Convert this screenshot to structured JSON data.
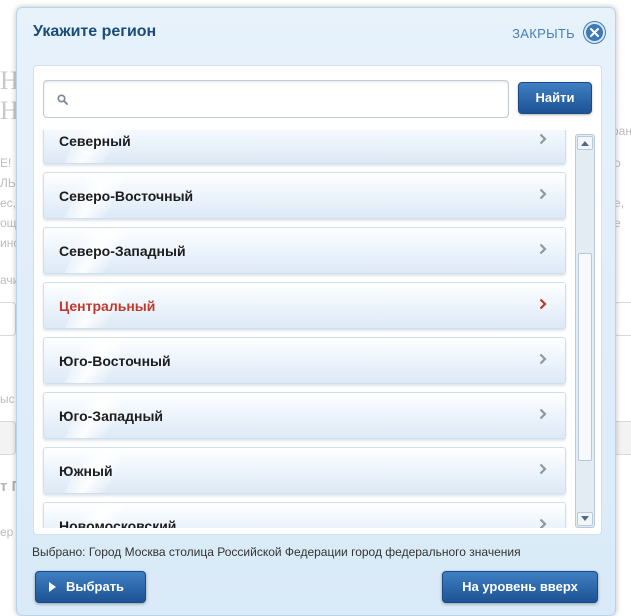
{
  "background": {
    "heading_fragments": [
      "Н",
      "Н"
    ],
    "text_fragments": [
      "E!",
      "ЛЬС",
      "ес,",
      "ощ",
      "ино",
      "ачи",
      "ыс",
      "т П",
      "ер"
    ],
    "right_fragments": [
      "ран",
      "о",
      "е,",
      "е"
    ]
  },
  "dialog": {
    "title": "Укажите регион",
    "close_label": "ЗАКРЫТЬ",
    "search": {
      "value": "",
      "placeholder": ""
    },
    "find_button": "Найти",
    "items": [
      {
        "label": "Северный",
        "active": false
      },
      {
        "label": "Северо-Восточный",
        "active": false
      },
      {
        "label": "Северо-Западный",
        "active": false
      },
      {
        "label": "Центральный",
        "active": true
      },
      {
        "label": "Юго-Восточный",
        "active": false
      },
      {
        "label": "Юго-Западный",
        "active": false
      },
      {
        "label": "Южный",
        "active": false
      },
      {
        "label": "Новомосковский",
        "active": false
      }
    ],
    "selected_text": "Выбрано: Город Москва столица Российской Федерации город федерального значения",
    "select_button": "Выбрать",
    "level_up_button": "На уровень вверх",
    "colors": {
      "accent": "#1d5394",
      "active_item": "#c0392b",
      "title": "#1c4b7a",
      "link": "#4a7fb5"
    }
  }
}
